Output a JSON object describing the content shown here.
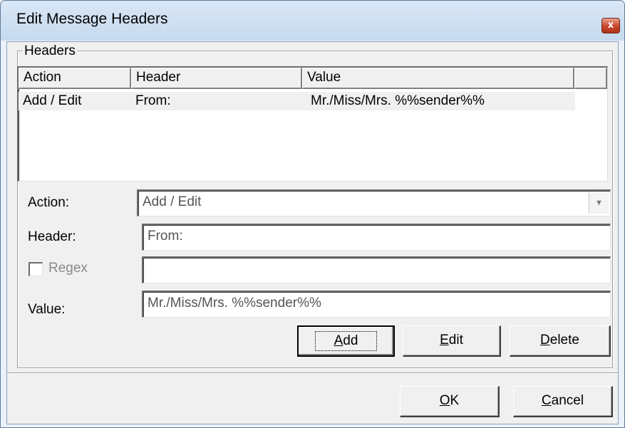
{
  "window": {
    "title": "Edit Message Headers",
    "close_glyph": "x"
  },
  "headers_group": {
    "legend": "Headers",
    "columns": [
      "Action",
      "Header",
      "Value"
    ],
    "rows": [
      {
        "action": "Add / Edit",
        "header": "From:",
        "value": "Mr./Miss/Mrs. %%sender%%"
      }
    ]
  },
  "form": {
    "action_label": "Action:",
    "action_value": "Add / Edit",
    "header_label": "Header:",
    "header_value": "From:",
    "regex_label": "Regex",
    "regex_checked": false,
    "regex_value": "",
    "value_label": "Value:",
    "value_value": "Mr./Miss/Mrs. %%sender%%"
  },
  "buttons": {
    "add_mn": "A",
    "add_rest": "dd",
    "edit_mn": "E",
    "edit_rest": "dit",
    "delete_mn": "D",
    "delete_rest": "elete",
    "ok_mn": "O",
    "ok_rest": "K",
    "cancel_mn": "C",
    "cancel_rest": "ancel"
  },
  "icons": {
    "close": "close-icon",
    "combo": "chevron-down-icon"
  },
  "colors": {
    "title_bar": "#c6d9ee",
    "close_button": "#c8452c",
    "dialog_bg": "#f0f0f0"
  }
}
